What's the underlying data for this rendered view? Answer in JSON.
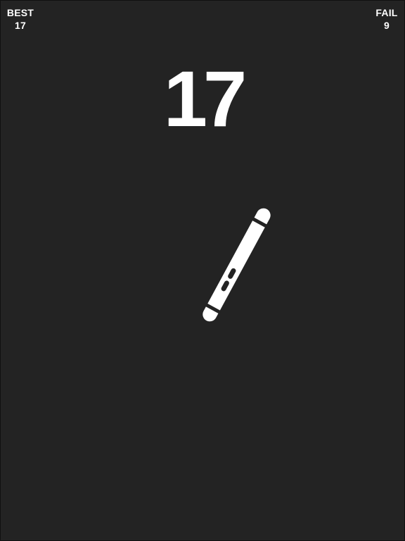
{
  "hud": {
    "best_label": "BEST",
    "best_value": "17",
    "fail_label": "FAIL",
    "fail_value": "9"
  },
  "score": "17",
  "colors": {
    "background": "#232323",
    "foreground": "#ffffff"
  },
  "icons": {
    "pen": "pen-icon"
  }
}
